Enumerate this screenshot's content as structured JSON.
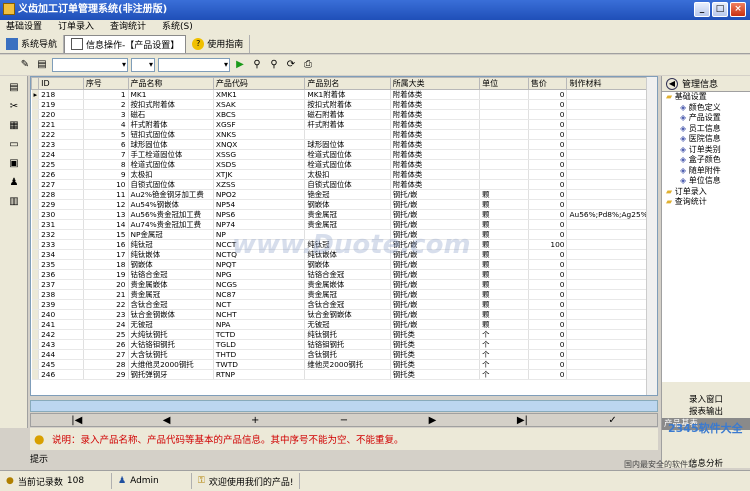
{
  "app": {
    "title": "义齿加工订单管理系统(非注册版)",
    "win_buttons": [
      "_",
      "□",
      "×"
    ]
  },
  "menu": [
    "基础设置",
    "订单录入",
    "查询统计",
    "系统(S)"
  ],
  "tabs": [
    {
      "label": "系统导航"
    },
    {
      "label": "信息操作-【产品设置】"
    },
    {
      "label": "使用指南"
    }
  ],
  "grid": {
    "columns": [
      "ID",
      "序号",
      "产品名称",
      "产品代码",
      "产品别名",
      "所属大类",
      "单位",
      "售价",
      "制作材料"
    ],
    "rows": [
      [
        "218",
        "1",
        "MK1",
        "XMK1",
        "MK1附着体",
        "附着体类",
        "",
        "0",
        ""
      ],
      [
        "219",
        "2",
        "按扣式附着体",
        "XSAK",
        "按扣式附着体",
        "附着体类",
        "",
        "0",
        ""
      ],
      [
        "220",
        "3",
        "磁石",
        "XBCS",
        "磁石附着体",
        "附着体类",
        "",
        "0",
        ""
      ],
      [
        "221",
        "4",
        "杆式附着体",
        "XGSF",
        "杆式附着体",
        "附着体类",
        "",
        "0",
        ""
      ],
      [
        "222",
        "5",
        "钮扣式固位体",
        "XNKS",
        "",
        "附着体类",
        "",
        "0",
        ""
      ],
      [
        "223",
        "6",
        "球形固位体",
        "XNQX",
        "球形固位体",
        "附着体类",
        "",
        "0",
        ""
      ],
      [
        "224",
        "7",
        "手工栓道固位体",
        "XSSG",
        "栓道式固位体",
        "附着体类",
        "",
        "0",
        ""
      ],
      [
        "225",
        "8",
        "栓道式固位体",
        "XSDS",
        "栓道式固位体",
        "附着体类",
        "",
        "0",
        ""
      ],
      [
        "226",
        "9",
        "太极扣",
        "XTJK",
        "太极扣",
        "附着体类",
        "",
        "0",
        ""
      ],
      [
        "227",
        "10",
        "自锁式固位体",
        "XZSS",
        "自锁式固位体",
        "附着体类",
        "",
        "0",
        ""
      ],
      [
        "228",
        "11",
        "Au2%铯金钢牙加工费",
        "NPO2",
        "铯金冠",
        "钢托/嵌",
        "颗",
        "0",
        ""
      ],
      [
        "229",
        "12",
        "Au54%钢嵌体",
        "NP54",
        "钢嵌体",
        "钢托/嵌",
        "颗",
        "0",
        ""
      ],
      [
        "230",
        "13",
        "Au56%贵金冠加工费",
        "NPS6",
        "贵金属冠",
        "钢托/嵌",
        "颗",
        "0",
        "Au56%;Pd8%;Ag25%;Cu"
      ],
      [
        "231",
        "14",
        "Au74%贵金冠加工费",
        "NP74",
        "贵金属冠",
        "钢托/嵌",
        "颗",
        "0",
        ""
      ],
      [
        "232",
        "15",
        "NP金属冠",
        "NP",
        "",
        "钢托/嵌",
        "颗",
        "0",
        ""
      ],
      [
        "233",
        "16",
        "纯钛冠",
        "NCCT",
        "纯钛冠",
        "钢托/嵌",
        "颗",
        "100",
        ""
      ],
      [
        "234",
        "17",
        "纯钛嵌体",
        "NCTQ",
        "纯钛嵌体",
        "钢托/嵌",
        "颗",
        "0",
        ""
      ],
      [
        "235",
        "18",
        "钢嵌体",
        "NPQT",
        "钢嵌体",
        "钢托/嵌",
        "颗",
        "0",
        ""
      ],
      [
        "236",
        "19",
        "钴铬合金冠",
        "NPG",
        "钴铬合金冠",
        "钢托/嵌",
        "颗",
        "0",
        ""
      ],
      [
        "237",
        "20",
        "贵金属嵌体",
        "NCGS",
        "贵金属嵌体",
        "钢托/嵌",
        "颗",
        "0",
        ""
      ],
      [
        "238",
        "21",
        "贵金属冠",
        "NC87",
        "贵金属冠",
        "钢托/嵌",
        "颗",
        "0",
        ""
      ],
      [
        "239",
        "22",
        "含钛合金冠",
        "NCT",
        "含钛合金冠",
        "钢托/嵌",
        "颗",
        "0",
        ""
      ],
      [
        "240",
        "23",
        "钛合金钢嵌体",
        "NCHT",
        "钛合金钢嵌体",
        "钢托/嵌",
        "颗",
        "0",
        ""
      ],
      [
        "241",
        "24",
        "无铍冠",
        "NPA",
        "无铍冠",
        "钢托/嵌",
        "颗",
        "0",
        ""
      ],
      [
        "242",
        "25",
        "大纯钛钢托",
        "TCTD",
        "纯钛钢托",
        "钢托类",
        "个",
        "0",
        ""
      ],
      [
        "243",
        "26",
        "大钴铬钼钢托",
        "TGLD",
        "钴铬钼钢托",
        "钢托类",
        "个",
        "0",
        ""
      ],
      [
        "244",
        "27",
        "大含钛钢托",
        "THTD",
        "含钛钢托",
        "钢托类",
        "个",
        "0",
        ""
      ],
      [
        "245",
        "28",
        "大维他灵2000钢托",
        "TWTD",
        "维他灵2000钢托",
        "钢托类",
        "个",
        "0",
        ""
      ],
      [
        "246",
        "29",
        "钢托弹钢牙",
        "RTNP",
        "",
        "钢托类",
        "个",
        "0",
        ""
      ]
    ],
    "first_row_id_cell": "218"
  },
  "nav": [
    "|◀",
    "◀",
    "+",
    "−",
    "▶",
    "▶|",
    "✓"
  ],
  "info": {
    "text": "说明：录入产品名称、产品代码等基本的产品信息。其中序号不能为空、不能重复。",
    "hint": "提示"
  },
  "right_panel": {
    "title": "管理信息",
    "tree": [
      "基础设置",
      "颜色定义",
      "产品设置",
      "员工信息",
      "医院信息",
      "订单类别",
      "盒子颜色",
      "随单附件",
      "单位信息",
      "订单录入",
      "查询统计"
    ],
    "buttons": [
      "录入窗口",
      "报表输出",
      "产品基表"
    ],
    "bottom": "信息分析"
  },
  "status": {
    "records_label": "当前记录数",
    "records": "108",
    "user": "Admin",
    "welcome": "欢迎使用我们的产品!"
  },
  "watermark": "www.Duote.com",
  "brand": "2345软件大全",
  "brand_sub": "国内最安全的软件站"
}
